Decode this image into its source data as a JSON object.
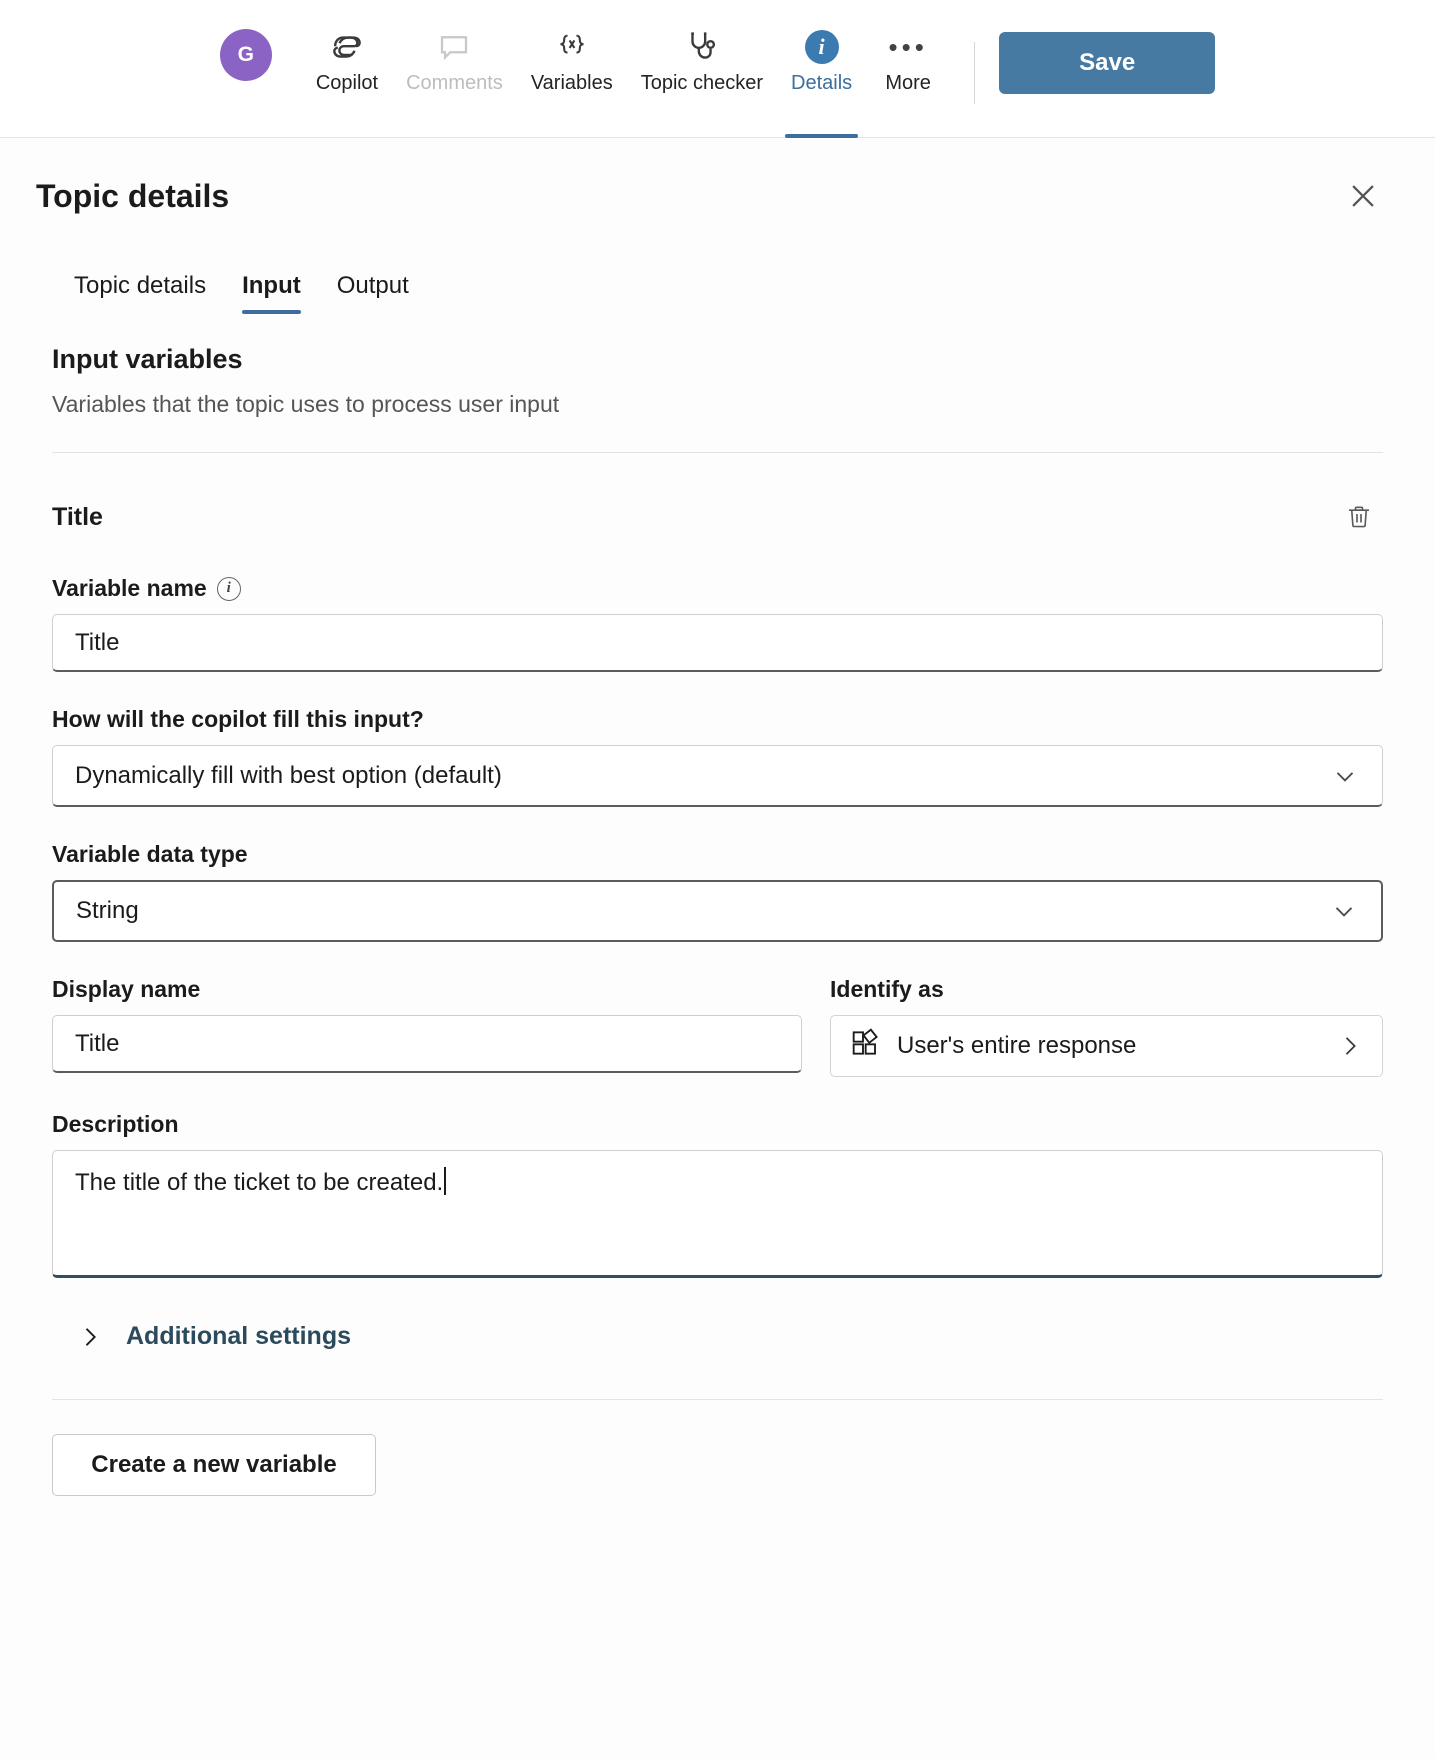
{
  "topbar": {
    "avatar_initial": "G",
    "commands": [
      {
        "label": "Copilot",
        "icon": "copilot-icon",
        "state": "normal"
      },
      {
        "label": "Comments",
        "icon": "comment-icon",
        "state": "disabled"
      },
      {
        "label": "Variables",
        "icon": "variables-braces-icon",
        "state": "normal"
      },
      {
        "label": "Topic checker",
        "icon": "stethoscope-icon",
        "state": "normal"
      },
      {
        "label": "Details",
        "icon": "info-circle-icon",
        "state": "active"
      },
      {
        "label": "More",
        "icon": "ellipsis-icon",
        "state": "normal"
      }
    ],
    "save_label": "Save",
    "accent_color": "#477aa3"
  },
  "panel": {
    "title": "Topic details",
    "close_icon": "close-icon",
    "tabs": [
      {
        "label": "Topic details",
        "selected": false
      },
      {
        "label": "Input",
        "selected": true
      },
      {
        "label": "Output",
        "selected": false
      }
    ],
    "section": {
      "title": "Input variables",
      "subtitle": "Variables that the topic uses to process user input"
    },
    "variable": {
      "name_heading": "Title",
      "delete_icon": "trash-icon",
      "variable_name": {
        "label": "Variable name",
        "info_icon": "info-icon",
        "value": "Title"
      },
      "fill_mode": {
        "label": "How will the copilot fill this input?",
        "value": "Dynamically fill with best option (default)",
        "chevron": "chevron-down-icon"
      },
      "data_type": {
        "label": "Variable data type",
        "value": "String",
        "chevron": "chevron-down-icon"
      },
      "display_name": {
        "label": "Display name",
        "value": "Title"
      },
      "identify_as": {
        "label": "Identify as",
        "value": "User's entire response",
        "icon": "entity-grid-icon",
        "chevron": "chevron-right-icon"
      },
      "description": {
        "label": "Description",
        "value": "The title of the ticket to be created."
      },
      "additional_settings": {
        "label": "Additional settings",
        "chevron": "chevron-right-icon"
      }
    },
    "create_variable_label": "Create a new variable"
  }
}
